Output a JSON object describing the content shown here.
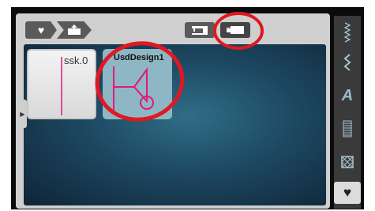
{
  "breadcrumb": {
    "favorites_icon": "♥",
    "import_icon": "folder-import-icon"
  },
  "sources": {
    "machine": "embroidery-machine-icon",
    "usb": "usb-stick-icon"
  },
  "files": [
    {
      "label": "ssk.0"
    },
    {
      "label": "UsdDesign1"
    }
  ],
  "rail": {
    "items": [
      "stitch-icon",
      "zigzag-icon",
      "font-icon",
      "satin-icon",
      "embroidery-icon"
    ],
    "favorites": "♥"
  },
  "colors": {
    "thread_pink": "#e0197b",
    "annotation_red": "#e01822"
  }
}
